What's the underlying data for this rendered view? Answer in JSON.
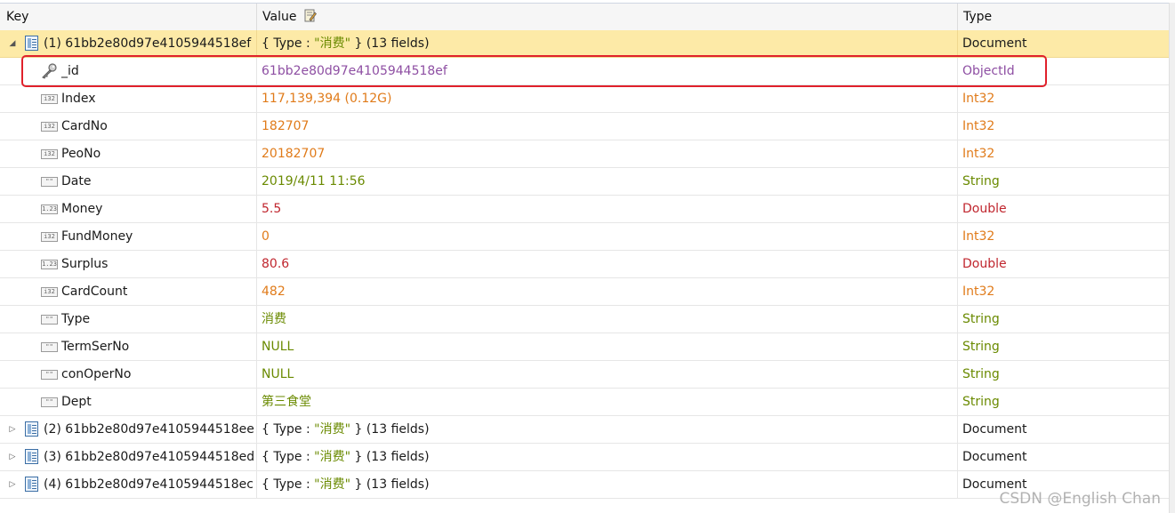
{
  "columns": {
    "key": "Key",
    "value": "Value",
    "type": "Type"
  },
  "documents": [
    {
      "index": "(1)",
      "id": "61bb2e80d97e4105944518ef",
      "summary_prefix": "{ Type : ",
      "summary_value": "\"消费\"",
      "summary_suffix": " } (13 fields)",
      "type": "Document",
      "expanded": true
    },
    {
      "index": "(2)",
      "id": "61bb2e80d97e4105944518ee",
      "summary_prefix": "{ Type : ",
      "summary_value": "\"消费\"",
      "summary_suffix": " } (13 fields)",
      "type": "Document",
      "expanded": false
    },
    {
      "index": "(3)",
      "id": "61bb2e80d97e4105944518ed",
      "summary_prefix": "{ Type : ",
      "summary_value": "\"消费\"",
      "summary_suffix": " } (13 fields)",
      "type": "Document",
      "expanded": false
    },
    {
      "index": "(4)",
      "id": "61bb2e80d97e4105944518ec",
      "summary_prefix": "{ Type : ",
      "summary_value": "\"消费\"",
      "summary_suffix": " } (13 fields)",
      "type": "Document",
      "expanded": false
    }
  ],
  "fields": [
    {
      "key": "_id",
      "value": "61bb2e80d97e4105944518ef",
      "type": "ObjectId",
      "icon": "key-icon",
      "icon_text": "",
      "color": "#8e4fa3"
    },
    {
      "key": "Index",
      "value": "117,139,394 (0.12G)",
      "type": "Int32",
      "icon": "int32-icon",
      "icon_text": "i32",
      "color": "#e07b1a"
    },
    {
      "key": "CardNo",
      "value": "182707",
      "type": "Int32",
      "icon": "int32-icon",
      "icon_text": "i32",
      "color": "#e07b1a"
    },
    {
      "key": "PeoNo",
      "value": "20182707",
      "type": "Int32",
      "icon": "int32-icon",
      "icon_text": "i32",
      "color": "#e07b1a"
    },
    {
      "key": "Date",
      "value": "2019/4/11 11:56",
      "type": "String",
      "icon": "string-icon",
      "icon_text": "\"\"",
      "color": "#6a8a00"
    },
    {
      "key": "Money",
      "value": "5.5",
      "type": "Double",
      "icon": "double-icon",
      "icon_text": "1.23",
      "color": "#c0262e"
    },
    {
      "key": "FundMoney",
      "value": "0",
      "type": "Int32",
      "icon": "int32-icon",
      "icon_text": "i32",
      "color": "#e07b1a"
    },
    {
      "key": "Surplus",
      "value": "80.6",
      "type": "Double",
      "icon": "double-icon",
      "icon_text": "1.23",
      "color": "#c0262e"
    },
    {
      "key": "CardCount",
      "value": "482",
      "type": "Int32",
      "icon": "int32-icon",
      "icon_text": "i32",
      "color": "#e07b1a"
    },
    {
      "key": "Type",
      "value": "消费",
      "type": "String",
      "icon": "string-icon",
      "icon_text": "\"\"",
      "color": "#6a8a00"
    },
    {
      "key": "TermSerNo",
      "value": "NULL",
      "type": "String",
      "icon": "string-icon",
      "icon_text": "\"\"",
      "color": "#6a8a00"
    },
    {
      "key": "conOperNo",
      "value": "NULL",
      "type": "String",
      "icon": "string-icon",
      "icon_text": "\"\"",
      "color": "#6a8a00"
    },
    {
      "key": "Dept",
      "value": "第三食堂",
      "type": "String",
      "icon": "string-icon",
      "icon_text": "\"\"",
      "color": "#6a8a00"
    }
  ],
  "watermark": "CSDN @English Chan"
}
